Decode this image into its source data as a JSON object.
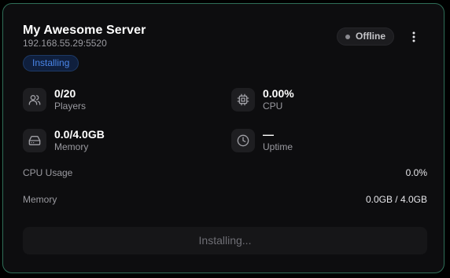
{
  "server": {
    "name": "My Awesome Server",
    "address": "192.168.55.29:5520",
    "install_badge": "Installing",
    "status": "Offline"
  },
  "stats": {
    "players": {
      "value": "0/20",
      "label": "Players",
      "icon": "users-icon"
    },
    "cpu": {
      "value": "0.00%",
      "label": "CPU",
      "icon": "cpu-icon"
    },
    "memory": {
      "value": "0.0/4.0GB",
      "label": "Memory",
      "icon": "hard-drive-icon"
    },
    "uptime": {
      "value": "—",
      "label": "Uptime",
      "icon": "clock-icon"
    }
  },
  "metrics": {
    "cpu_usage": {
      "label": "CPU Usage",
      "value": "0.0%"
    },
    "memory": {
      "label": "Memory",
      "value": "0.0GB / 4.0GB"
    }
  },
  "action": {
    "label": "Installing..."
  },
  "colors": {
    "card_border": "#2f6e58",
    "card_bg": "#0d0d0f",
    "badge_text": "#4a86e8",
    "badge_bg": "#0f1f3d",
    "status_dot": "#8a8a90"
  }
}
